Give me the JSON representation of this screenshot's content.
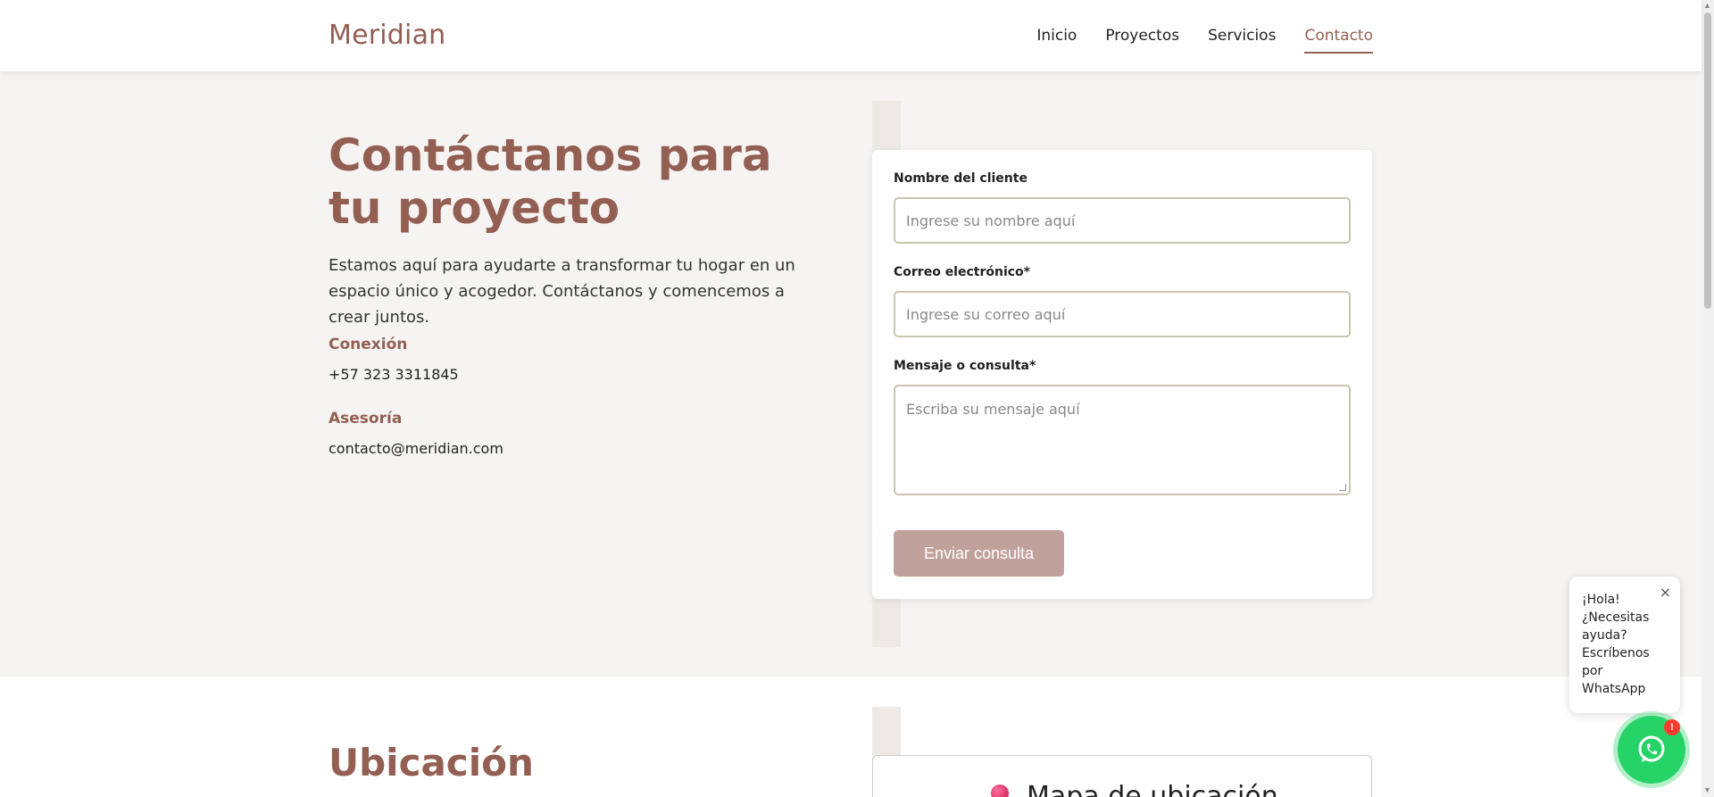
{
  "header": {
    "logo": "Meridian",
    "nav": [
      "Inicio",
      "Proyectos",
      "Servicios",
      "Contacto"
    ],
    "active": "Contacto"
  },
  "hero": {
    "title": "Contáctanos para tu proyecto",
    "intro": "Estamos aquí para ayudarte a transformar tu hogar en un espacio único y acogedor. Contáctanos y comencemos a crear juntos.",
    "info": [
      {
        "label": "Conexión",
        "value": "+57 323 3311845"
      },
      {
        "label": "Asesoría",
        "value": "contacto@meridian.com"
      }
    ]
  },
  "form": {
    "name_label": "Nombre del cliente",
    "name_placeholder": "Ingrese su nombre aquí",
    "email_label": "Correo electrónico*",
    "email_placeholder": "Ingrese su correo aquí",
    "message_label": "Mensaje o consulta*",
    "message_placeholder": "Escriba su mensaje aquí",
    "submit_label": "Enviar consulta"
  },
  "location": {
    "title": "Ubicación",
    "map_title": "Mapa de ubicación"
  },
  "whatsapp": {
    "bubble_text": "¡Hola! ¿Necesitas ayuda? Escríbenos por WhatsApp",
    "badge": "!",
    "close": "×"
  },
  "colors": {
    "brand": "#935f52",
    "button": "#c1a19b",
    "whatsapp": "#25d366"
  }
}
